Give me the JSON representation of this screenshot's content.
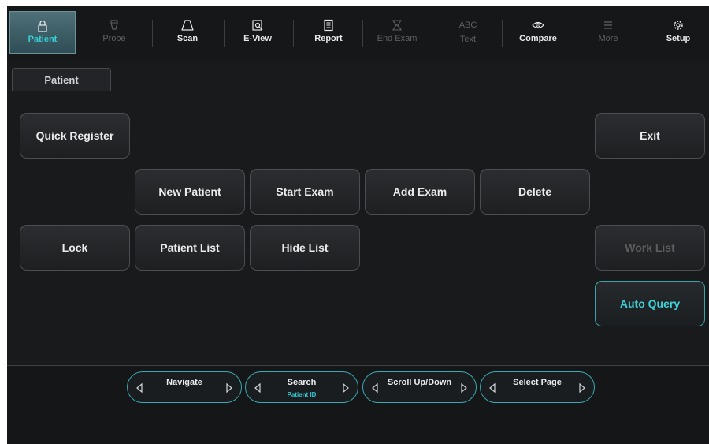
{
  "toolbar": {
    "items": [
      {
        "label": "Patient",
        "icon": "lock-icon",
        "state": "active"
      },
      {
        "label": "Probe",
        "icon": "probe-icon",
        "state": "disabled"
      },
      {
        "label": "Scan",
        "icon": "scan-icon",
        "state": "enabled"
      },
      {
        "label": "E-View",
        "icon": "eview-icon",
        "state": "enabled"
      },
      {
        "label": "Report",
        "icon": "report-icon",
        "state": "enabled"
      },
      {
        "label": "End Exam",
        "icon": "end-exam-icon",
        "state": "disabled"
      },
      {
        "label": "Text",
        "icon_text": "ABC",
        "state": "disabled"
      },
      {
        "label": "Compare",
        "icon": "eye-icon",
        "state": "enabled"
      },
      {
        "label": "More",
        "icon": "menu-icon",
        "state": "disabled"
      },
      {
        "label": "Setup",
        "icon": "gear-icon",
        "state": "enabled"
      }
    ]
  },
  "tabs": [
    {
      "label": "Patient",
      "selected": true
    }
  ],
  "buttons": {
    "quick_register": "Quick Register",
    "exit": "Exit",
    "new_patient": "New Patient",
    "start_exam": "Start Exam",
    "add_exam": "Add Exam",
    "delete": "Delete",
    "lock": "Lock",
    "patient_list": "Patient List",
    "hide_list": "Hide List",
    "work_list": "Work List",
    "auto_query": "Auto Query"
  },
  "softkeys": [
    {
      "label": "Navigate",
      "sub": ""
    },
    {
      "label": "Search",
      "sub": "Patient ID"
    },
    {
      "label": "Scroll Up/Down",
      "sub": ""
    },
    {
      "label": "Select Page",
      "sub": ""
    }
  ],
  "colors": {
    "accent": "#3ed0d9",
    "background": "#181a1c",
    "disabled_text": "#5d6064"
  }
}
